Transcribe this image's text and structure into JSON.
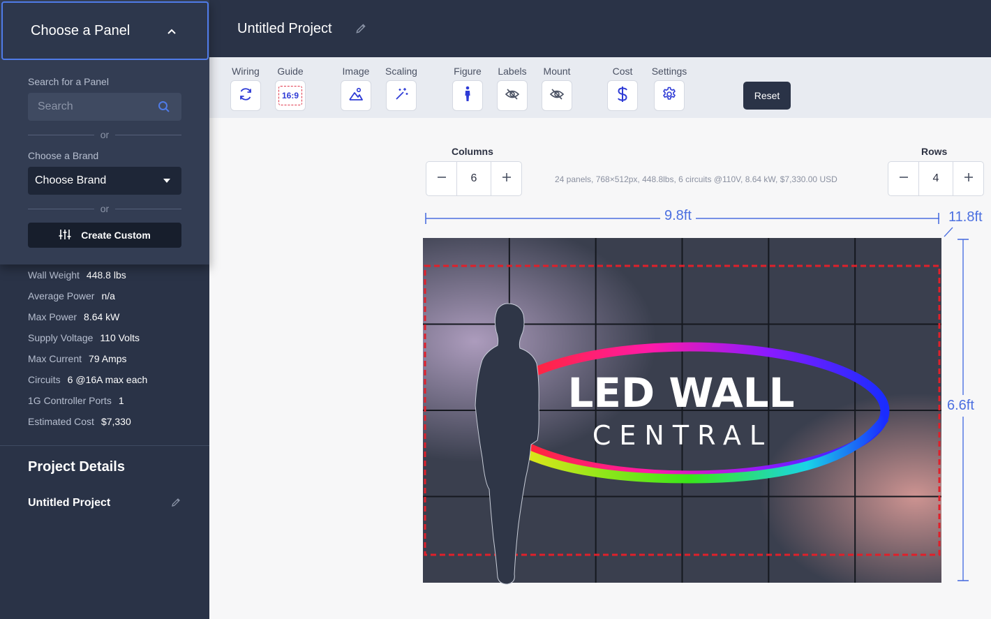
{
  "sidebar": {
    "panel_chooser": {
      "title": "Choose a Panel",
      "search_label": "Search for a Panel",
      "search_placeholder": "Search",
      "or_text": "or",
      "brand_label": "Choose a Brand",
      "brand_value": "Choose Brand",
      "create_custom": "Create Custom"
    },
    "stats": [
      {
        "label": "Wall Weight",
        "value": "448.8 lbs"
      },
      {
        "label": "Average Power",
        "value": "n/a"
      },
      {
        "label": "Max Power",
        "value": "8.64 kW"
      },
      {
        "label": "Supply Voltage",
        "value": "110 Volts"
      },
      {
        "label": "Max Current",
        "value": "79 Amps"
      },
      {
        "label": "Circuits",
        "value": "6 @16A max each"
      },
      {
        "label": "1G Controller Ports",
        "value": "1"
      },
      {
        "label": "Estimated Cost",
        "value": "$7,330"
      }
    ],
    "project_details": {
      "title": "Project Details",
      "name": "Untitled Project"
    }
  },
  "header": {
    "project_title": "Untitled Project"
  },
  "toolbar": {
    "tools": [
      {
        "label": "Wiring",
        "icon": "refresh-icon"
      },
      {
        "label": "Guide",
        "icon": "aspect-ratio-icon",
        "badge": "16:9"
      },
      {
        "label": "Image",
        "icon": "image-icon"
      },
      {
        "label": "Scaling",
        "icon": "magic-wand-icon"
      },
      {
        "label": "Figure",
        "icon": "person-icon"
      },
      {
        "label": "Labels",
        "icon": "eye-off-icon"
      },
      {
        "label": "Mount",
        "icon": "eye-off-icon"
      },
      {
        "label": "Cost",
        "icon": "dollar-icon"
      },
      {
        "label": "Settings",
        "icon": "gear-icon"
      }
    ],
    "reset_label": "Reset"
  },
  "controls": {
    "columns_label": "Columns",
    "columns_value": "6",
    "rows_label": "Rows",
    "rows_value": "4",
    "summary": "24 panels, 768×512px, 448.8lbs, 6 circuits @110V, 8.64 kW, $7,330.00 USD"
  },
  "dimensions": {
    "width": "9.8ft",
    "diagonal": "11.8ft",
    "height": "6.6ft"
  },
  "wall": {
    "columns": 6,
    "rows": 4,
    "logo_line1": "LED WALL",
    "logo_line2": "CENTRAL",
    "guide_color": "#e0202a",
    "accent_color": "#4b6fe0"
  }
}
